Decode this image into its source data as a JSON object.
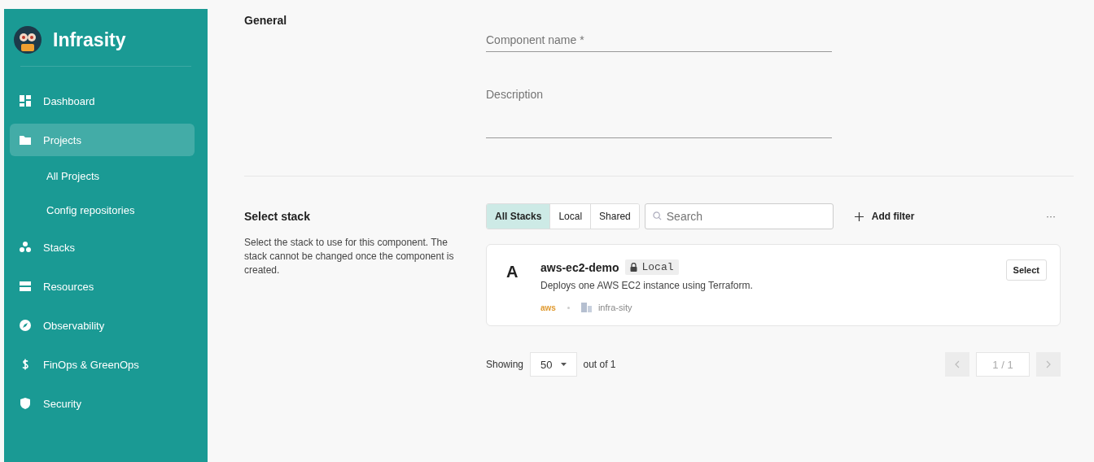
{
  "sidebar": {
    "brand": "Infrasity",
    "items": [
      {
        "kind": "nav",
        "label": "Dashboard",
        "selected": false
      },
      {
        "kind": "nav",
        "label": "Projects",
        "selected": true
      },
      {
        "kind": "sub",
        "label": "All Projects",
        "selected": false
      },
      {
        "kind": "sub",
        "label": "Config repositories",
        "selected": false
      },
      {
        "kind": "nav",
        "label": "Stacks",
        "selected": false
      },
      {
        "kind": "nav",
        "label": "Resources",
        "selected": false
      },
      {
        "kind": "nav",
        "label": "Observability",
        "selected": false
      },
      {
        "kind": "nav",
        "label": "FinOps & GreenOps",
        "selected": false
      },
      {
        "kind": "nav",
        "label": "Security",
        "selected": false
      }
    ]
  },
  "general": {
    "heading": "General",
    "fields": [
      {
        "placeholder": "Component name *"
      },
      {
        "placeholder": "Description"
      }
    ]
  },
  "stack": {
    "heading": "Select stack",
    "description": "Select the stack to use for this component. The stack cannot be changed once the component is created.",
    "tabs": [
      {
        "label": "All Stacks",
        "selected": true
      },
      {
        "label": "Local",
        "selected": false
      },
      {
        "label": "Shared",
        "selected": false
      }
    ],
    "search": {
      "placeholder": "Search"
    },
    "add_filter": "Add filter",
    "more": "···",
    "cards": [
      {
        "letter": "A",
        "name": "aws-ec2-demo",
        "badge": "Local",
        "description": "Deploys one AWS EC2 instance using Terraform.",
        "provider": "aws",
        "org": "infra-sity",
        "button": "Select"
      }
    ],
    "pagination": {
      "showing": "Showing",
      "page_size": "50",
      "out_of": "out of 1",
      "page": "1 / 1"
    }
  }
}
